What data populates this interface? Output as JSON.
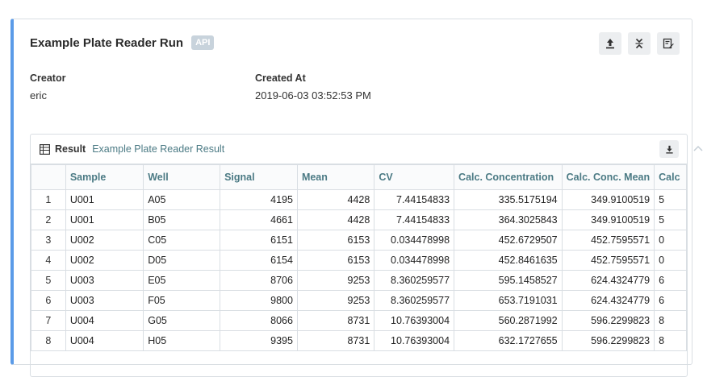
{
  "header": {
    "title": "Example Plate Reader Run",
    "badge": "API"
  },
  "meta": {
    "creator_label": "Creator",
    "creator_value": "eric",
    "created_label": "Created At",
    "created_value": "2019-06-03 03:52:53 PM"
  },
  "actions": [
    {
      "icon": "upload-icon"
    },
    {
      "icon": "collapse-icon"
    },
    {
      "icon": "edit-icon"
    }
  ],
  "result": {
    "label": "Result",
    "name": "Example Plate Reader Result"
  },
  "table": {
    "columns": [
      "",
      "Sample",
      "Well",
      "Signal",
      "Mean",
      "CV",
      "Calc. Concentration",
      "Calc. Conc. Mean",
      "Calc"
    ],
    "rows": [
      [
        "1",
        "U001",
        "A05",
        "4195",
        "4428",
        "7.44154833",
        "335.5175194",
        "349.9100519",
        "5"
      ],
      [
        "2",
        "U001",
        "B05",
        "4661",
        "4428",
        "7.44154833",
        "364.3025843",
        "349.9100519",
        "5"
      ],
      [
        "3",
        "U002",
        "C05",
        "6151",
        "6153",
        "0.034478998",
        "452.6729507",
        "452.7595571",
        "0"
      ],
      [
        "4",
        "U002",
        "D05",
        "6154",
        "6153",
        "0.034478998",
        "452.8461635",
        "452.7595571",
        "0"
      ],
      [
        "5",
        "U003",
        "E05",
        "8706",
        "9253",
        "8.360259577",
        "595.1458527",
        "624.4324779",
        "6"
      ],
      [
        "6",
        "U003",
        "F05",
        "9800",
        "9253",
        "8.360259577",
        "653.7191031",
        "624.4324779",
        "6"
      ],
      [
        "7",
        "U004",
        "G05",
        "8066",
        "8731",
        "10.76393004",
        "560.2871992",
        "596.2299823",
        "8"
      ],
      [
        "8",
        "U004",
        "H05",
        "9395",
        "8731",
        "10.76393004",
        "632.1727655",
        "596.2299823",
        "8"
      ]
    ]
  }
}
